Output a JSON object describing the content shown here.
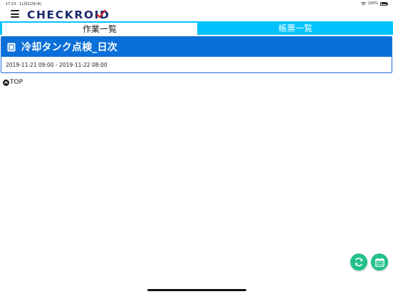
{
  "status_bar": {
    "time": "17:23",
    "date": "11月21日(木)",
    "battery": "100%"
  },
  "header": {
    "logo_text": "CHECKROID",
    "logo_color": "#1a2a6c",
    "logo_accent": "#e0262b"
  },
  "tabs": [
    {
      "label": "作業一覧",
      "active": true
    },
    {
      "label": "帳票一覧",
      "active": false
    }
  ],
  "report": {
    "title": "冷却タンク点検_日次",
    "period": "2019-11-21 09:00 - 2019-11-22 08:00"
  },
  "top_link": {
    "label": "TOP"
  },
  "colors": {
    "tab_bar": "#00c2ff",
    "title_bar": "#0b6fd9",
    "fab": "#22c08a"
  },
  "icons": {
    "menu": "hamburger-menu-icon",
    "document": "document-icon",
    "top": "arrow-up-circle-icon",
    "refresh": "refresh-icon",
    "calendar": "calendar-icon"
  }
}
